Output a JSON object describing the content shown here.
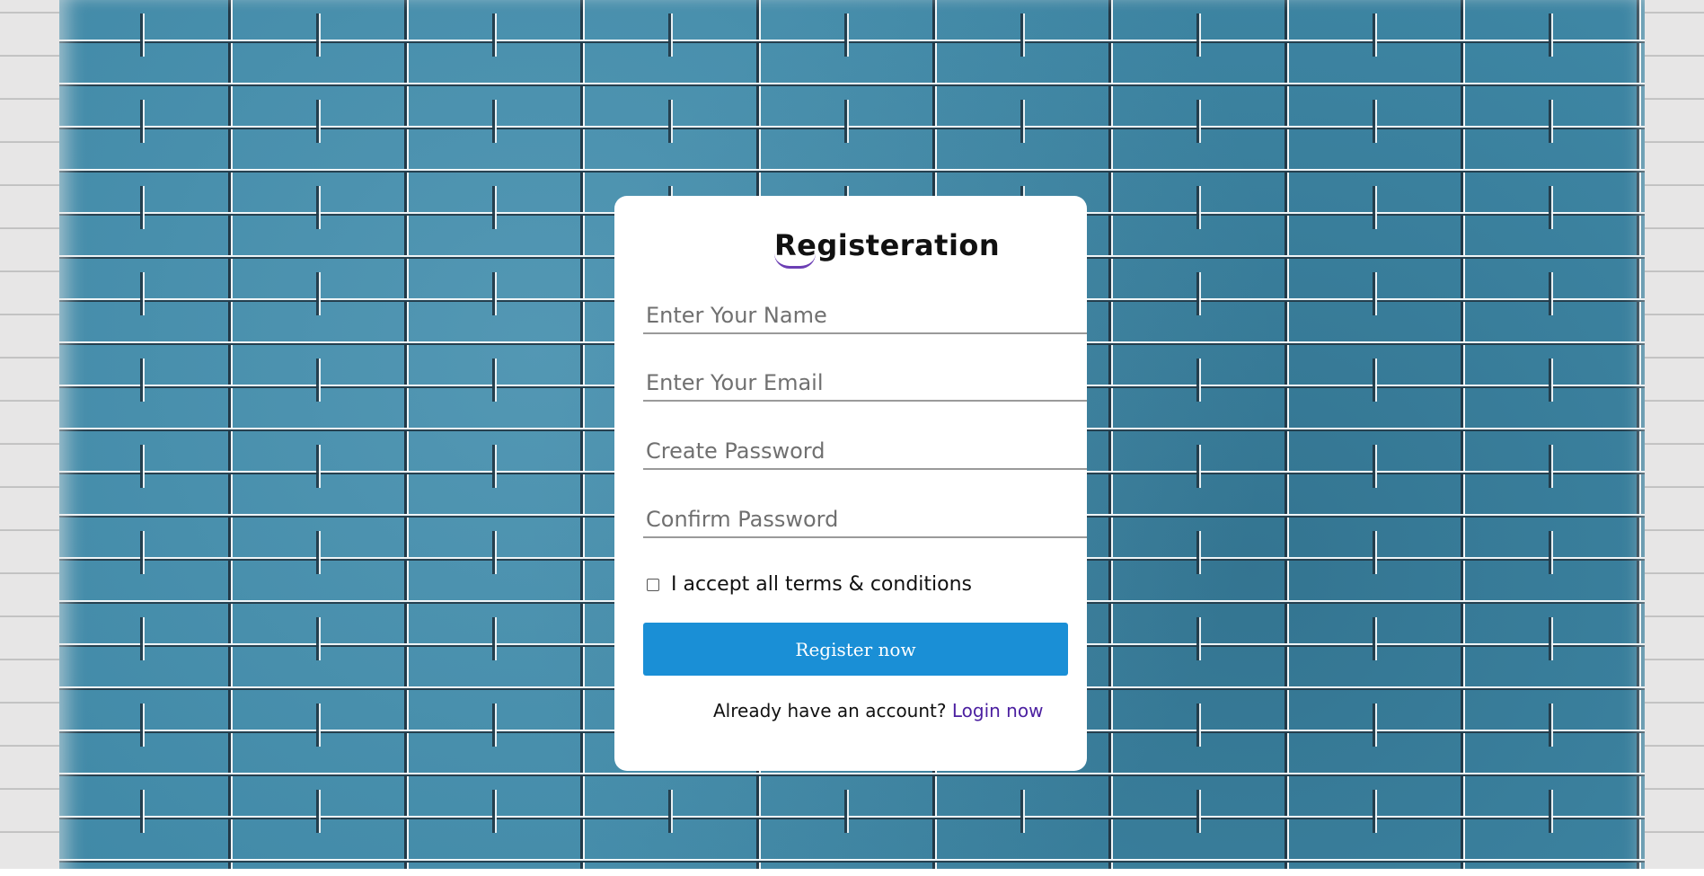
{
  "form": {
    "title": "Registeration",
    "fields": [
      {
        "name": "name",
        "placeholder": "Enter Your Name",
        "value": ""
      },
      {
        "name": "email",
        "placeholder": "Enter Your Email",
        "value": ""
      },
      {
        "name": "password",
        "placeholder": "Create Password",
        "value": ""
      },
      {
        "name": "confirm_password",
        "placeholder": "Confirm Password",
        "value": ""
      }
    ],
    "terms_label": "I accept all terms & conditions",
    "terms_checked": false,
    "submit_label": "Register now",
    "login_prompt": "Already have an account?",
    "login_link": "Login now"
  },
  "colors": {
    "button": "#1a8fd6",
    "link": "#4b1fa0",
    "title_accent": "#6c3fb4",
    "wall": "#3f88a6"
  }
}
